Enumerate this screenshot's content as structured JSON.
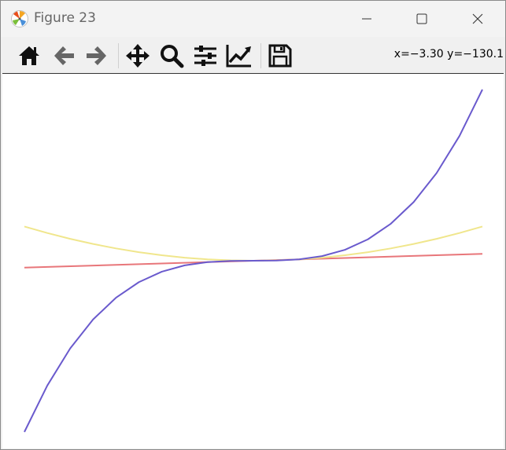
{
  "window": {
    "title": "Figure 23",
    "app_icon": "matplotlib-logo-icon",
    "controls": [
      "minimize-icon",
      "maximize-icon",
      "close-icon"
    ]
  },
  "toolbar": {
    "tools": [
      {
        "name": "home-button",
        "icon": "home-icon"
      },
      {
        "name": "back-button",
        "icon": "arrow-left-icon"
      },
      {
        "name": "forward-button",
        "icon": "arrow-right-icon"
      },
      {
        "name": "pan-button",
        "icon": "move-icon"
      },
      {
        "name": "zoom-button",
        "icon": "magnifier-icon"
      },
      {
        "name": "configure-subplots-button",
        "icon": "sliders-icon"
      },
      {
        "name": "edit-axis-button",
        "icon": "line-chart-icon"
      },
      {
        "name": "save-button",
        "icon": "floppy-disk-icon"
      }
    ],
    "coords_readout": "x=−3.30 y=−130.1"
  },
  "chart_data": {
    "type": "line",
    "xlim": [
      -5,
      5
    ],
    "ylim": [
      -125,
      125
    ],
    "grid": false,
    "axes_visible": false,
    "series": [
      {
        "color": "#e8767a",
        "x": [
          -5,
          5
        ],
        "y": [
          -5,
          5
        ]
      },
      {
        "color": "#f0e68c",
        "x": [
          -5,
          -4.5,
          -4,
          -3.5,
          -3,
          -2.5,
          -2,
          -1.5,
          -1,
          -0.5,
          0,
          0.5,
          1,
          1.5,
          2,
          2.5,
          3,
          3.5,
          4,
          4.5,
          5
        ],
        "y": [
          25,
          20.25,
          16,
          12.25,
          9,
          6.25,
          4,
          2.25,
          1,
          0.25,
          0,
          0.25,
          1,
          2.25,
          4,
          6.25,
          9,
          12.25,
          16,
          20.25,
          25
        ]
      },
      {
        "color": "#6a5acd",
        "x": [
          -5,
          -4.5,
          -4,
          -3.5,
          -3,
          -2.5,
          -2,
          -1.5,
          -1,
          -0.5,
          0,
          0.5,
          1,
          1.5,
          2,
          2.5,
          3,
          3.5,
          4,
          4.5,
          5
        ],
        "y": [
          -125,
          -91.125,
          -64,
          -42.875,
          -27,
          -15.625,
          -8,
          -3.375,
          -1,
          -0.125,
          0,
          0.125,
          1,
          3.375,
          8,
          15.625,
          27,
          42.875,
          64,
          91.125,
          125
        ]
      }
    ]
  }
}
